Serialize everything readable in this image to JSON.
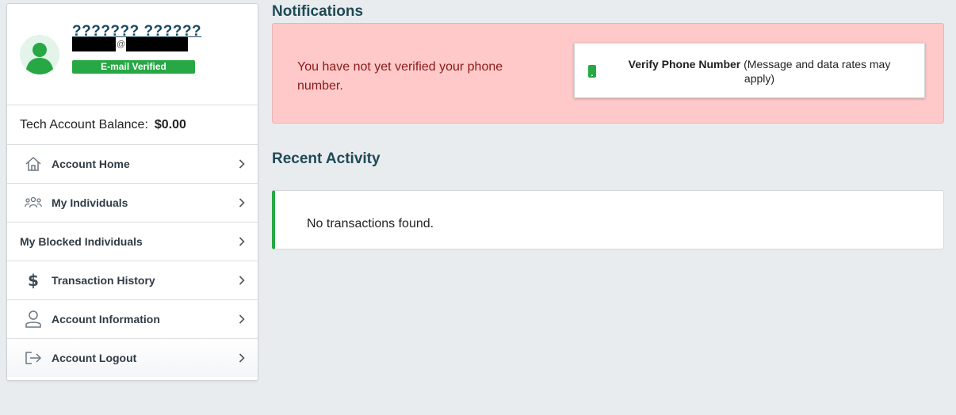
{
  "profile": {
    "name": "??????? ??????",
    "email_at": "@",
    "verified_badge": "E-mail Verified"
  },
  "balance": {
    "label": "Tech Account Balance:",
    "amount": "$0.00"
  },
  "nav": {
    "items": [
      {
        "label": "Account Home",
        "icon": "home-icon"
      },
      {
        "label": "My Individuals",
        "icon": "people-icon"
      },
      {
        "label": "My Blocked Individuals",
        "icon": ""
      },
      {
        "label": "Transaction History",
        "icon": "dollar-icon"
      },
      {
        "label": "Account Information",
        "icon": "user-icon"
      },
      {
        "label": "Account Logout",
        "icon": "logout-icon"
      }
    ]
  },
  "notifications": {
    "title": "Notifications",
    "message": "You have not yet verified your phone number.",
    "verify_button": {
      "label_main": "Verify Phone Number",
      "label_note": " (Message and data rates may apply)"
    }
  },
  "recent_activity": {
    "title": "Recent Activity",
    "empty_message": "No transactions found."
  },
  "colors": {
    "accent_green": "#27a844",
    "alert_bg": "#ffc9c9",
    "alert_text": "#8b1a1a",
    "heading": "#1f4a55"
  }
}
